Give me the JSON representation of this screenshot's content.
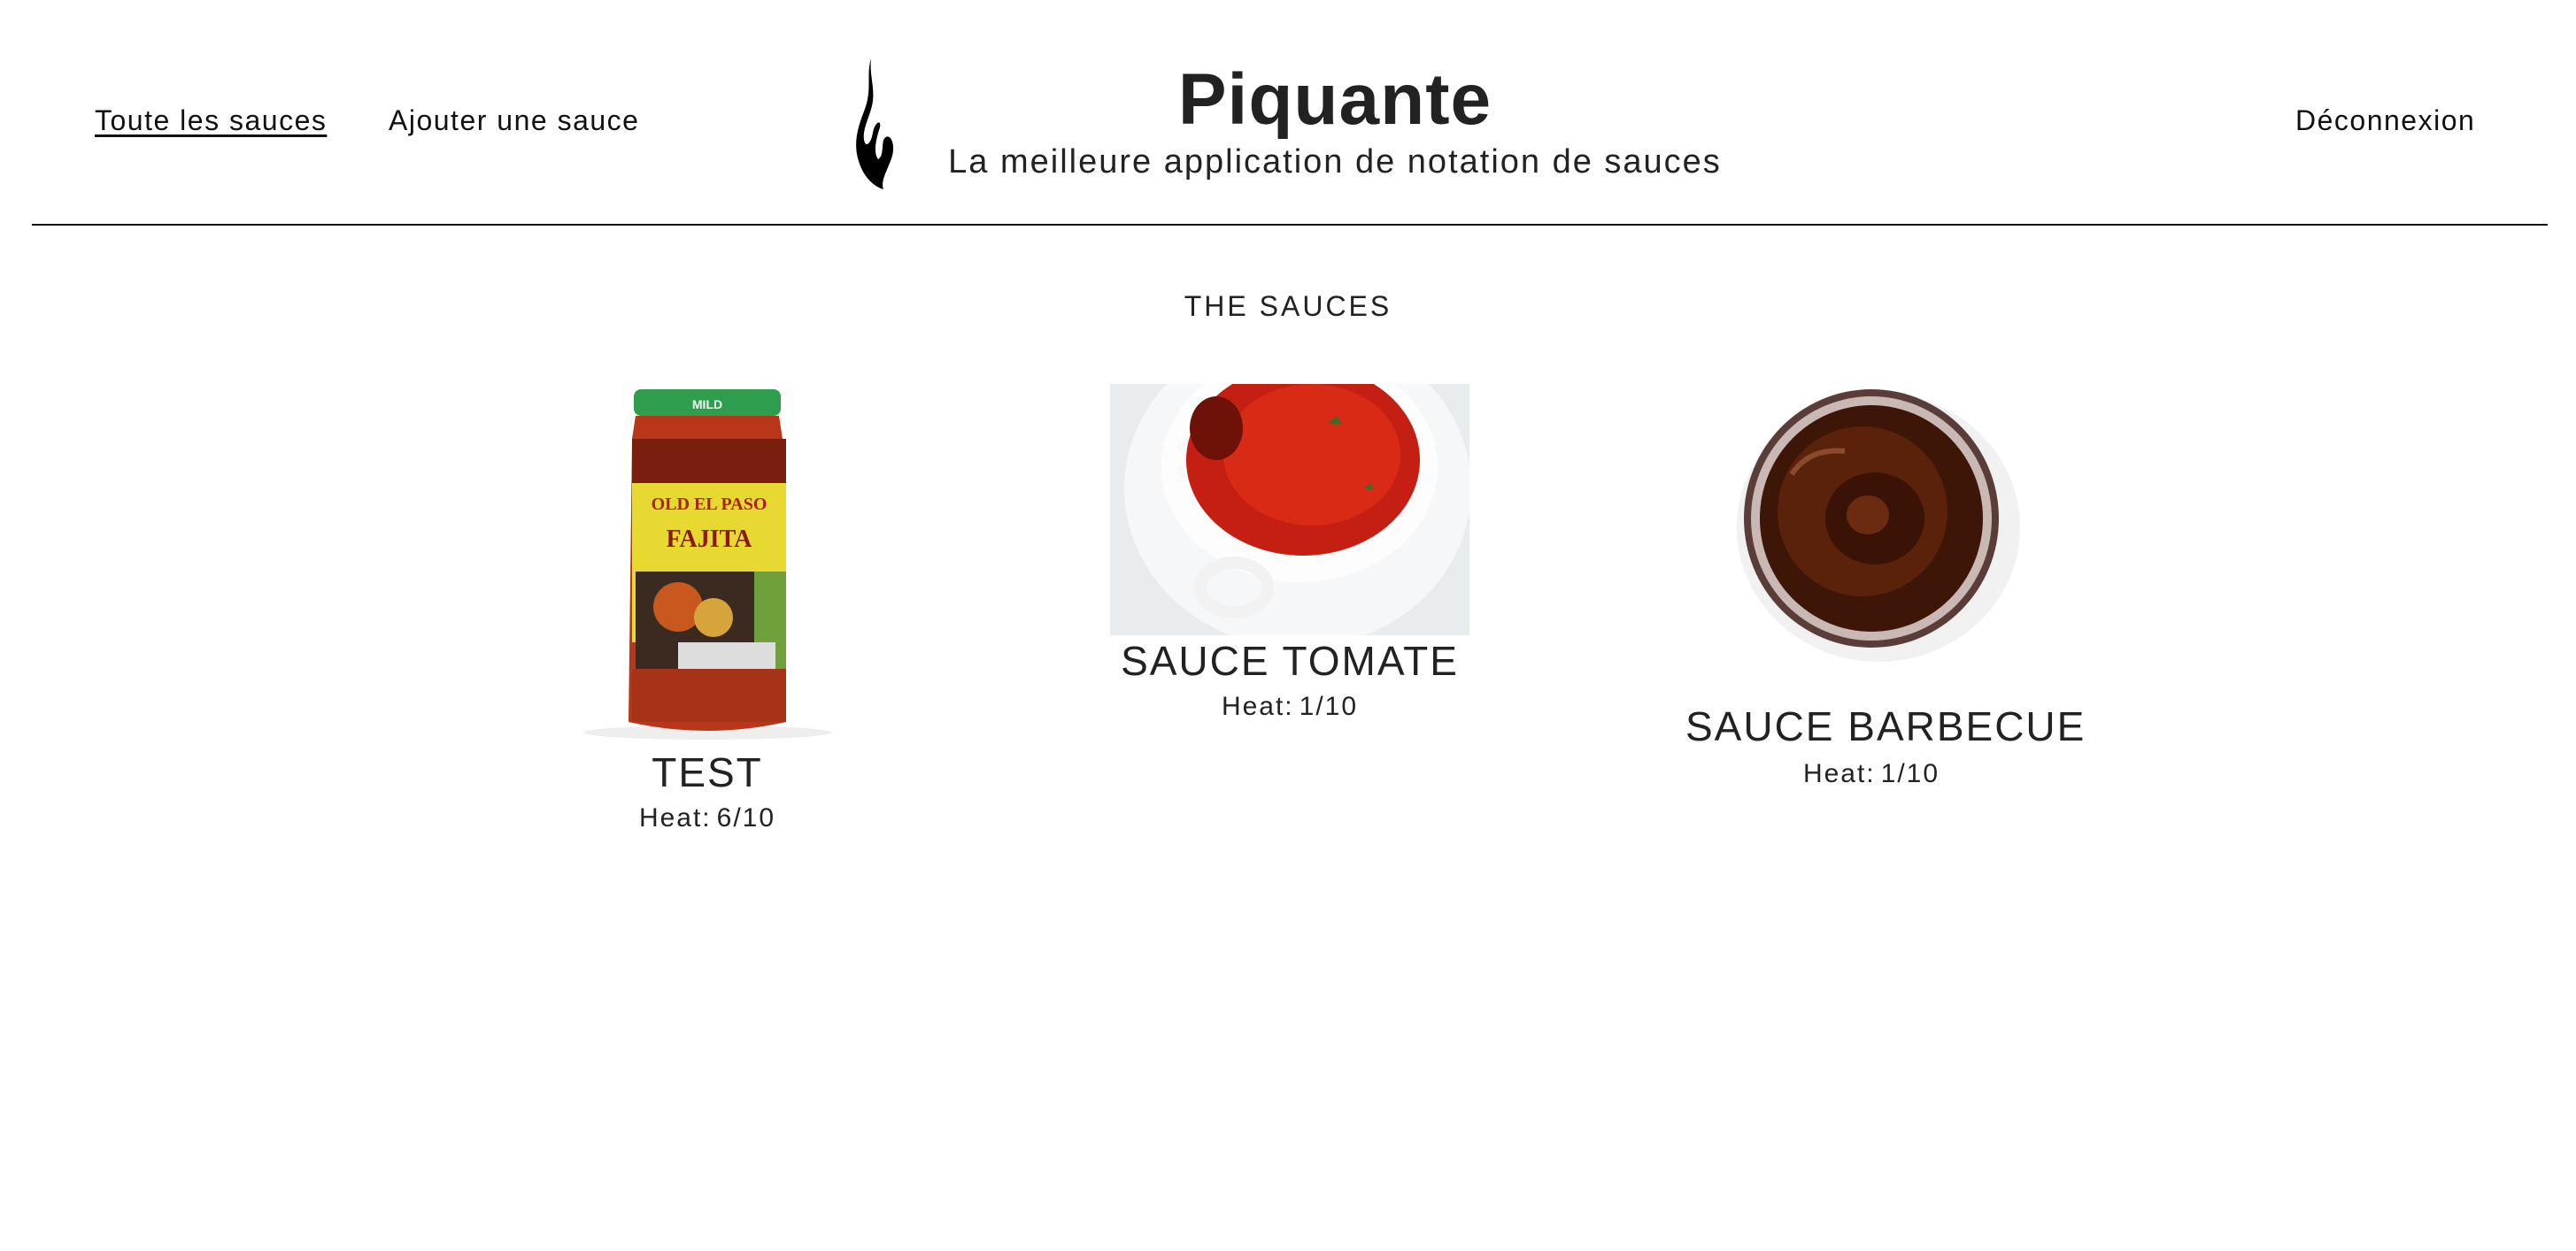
{
  "header": {
    "nav": {
      "all_sauces": "Toute les sauces",
      "add_sauce": "Ajouter une sauce",
      "logout": "Déconnexion"
    },
    "logo_icon": "flame-icon",
    "title": "Piquante",
    "subtitle": "La meilleure application de notation de sauces"
  },
  "main": {
    "section_title": "THE SAUCES",
    "sauces": [
      {
        "name": "TEST",
        "heat_label": "Heat:",
        "heat_value": "6/10",
        "image": "jar-image"
      },
      {
        "name": "SAUCE TOMATE",
        "heat_label": "Heat:",
        "heat_value": "1/10",
        "image": "tomato-bowl-image"
      },
      {
        "name": "SAUCE BARBECUE",
        "heat_label": "Heat:",
        "heat_value": "1/10",
        "image": "bbq-bowl-image"
      }
    ]
  },
  "colors": {
    "text": "#222222",
    "divider": "#111111",
    "background": "#ffffff"
  }
}
